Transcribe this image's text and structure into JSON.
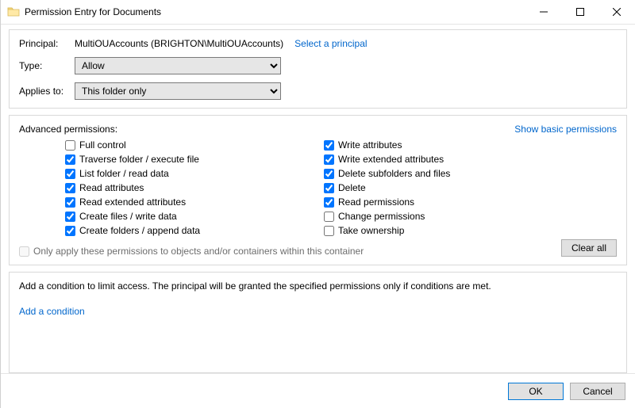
{
  "window": {
    "title": "Permission Entry for Documents"
  },
  "rows": {
    "principal_label": "Principal:",
    "principal_value": "MultiOUAccounts (BRIGHTON\\MultiOUAccounts)",
    "select_principal": "Select a principal",
    "type_label": "Type:",
    "type_value": "Allow",
    "applies_label": "Applies to:",
    "applies_value": "This folder only"
  },
  "adv": {
    "heading": "Advanced permissions:",
    "show_basic": "Show basic permissions",
    "left": [
      {
        "label": "Full control",
        "checked": false
      },
      {
        "label": "Traverse folder / execute file",
        "checked": true
      },
      {
        "label": "List folder / read data",
        "checked": true
      },
      {
        "label": "Read attributes",
        "checked": true
      },
      {
        "label": "Read extended attributes",
        "checked": true
      },
      {
        "label": "Create files / write data",
        "checked": true
      },
      {
        "label": "Create folders / append data",
        "checked": true
      }
    ],
    "right": [
      {
        "label": "Write attributes",
        "checked": true
      },
      {
        "label": "Write extended attributes",
        "checked": true
      },
      {
        "label": "Delete subfolders and files",
        "checked": true
      },
      {
        "label": "Delete",
        "checked": true
      },
      {
        "label": "Read permissions",
        "checked": true
      },
      {
        "label": "Change permissions",
        "checked": false
      },
      {
        "label": "Take ownership",
        "checked": false
      }
    ],
    "only_apply": "Only apply these permissions to objects and/or containers within this container",
    "clear_all": "Clear all"
  },
  "cond": {
    "text": "Add a condition to limit access. The principal will be granted the specified permissions only if conditions are met.",
    "add": "Add a condition"
  },
  "footer": {
    "ok": "OK",
    "cancel": "Cancel"
  }
}
